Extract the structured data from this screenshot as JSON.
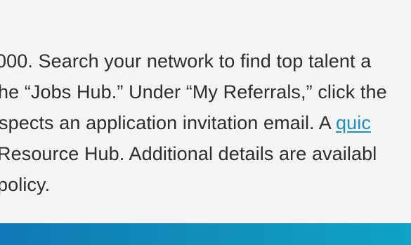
{
  "content": {
    "line1": "000. Search your network to find top talent a",
    "line2": "he “Jobs Hub.” Under “My Referrals,” click the",
    "line3_before_link": "spects an application invitation email. A ",
    "line3_link": "quic",
    "line4": "Resource Hub. Additional details are availabl",
    "line5": "policy."
  },
  "colors": {
    "text": "#2d2d2d",
    "link": "#1a8fc8",
    "background": "#f4f4f4",
    "footer_band_start": "#0f78b6",
    "footer_band_end": "#0fa3c6"
  }
}
